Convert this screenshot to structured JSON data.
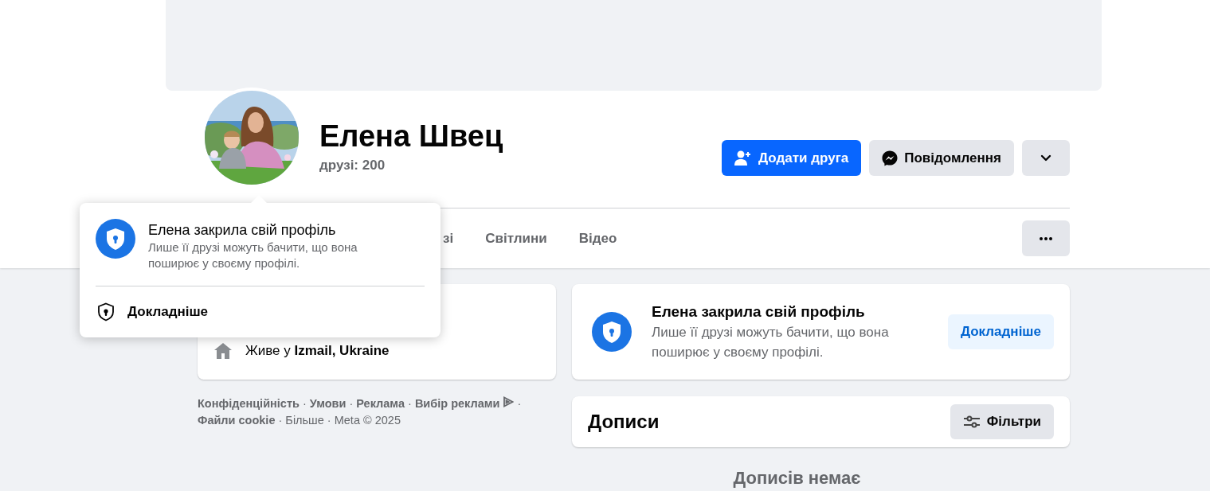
{
  "profile": {
    "name": "Елена Швец",
    "friends": "друзі: 200"
  },
  "actions": [
    {
      "kind": "add_friend",
      "label": "Додати друга"
    },
    {
      "kind": "message",
      "label": "Повідомлення"
    },
    {
      "kind": "dropdown"
    }
  ],
  "tabs": [
    {
      "label": "зі",
      "selected": false
    },
    {
      "label": "Світлини",
      "selected": false
    },
    {
      "label": "Відео",
      "selected": false
    }
  ],
  "popup": {
    "title": "Елена закрила свій профіль",
    "text": "Лише її друзі можуть бачити, що вона поширює у своєму профілі.",
    "link": "Докладніше"
  },
  "intro": {
    "lives_in": "Живе у **Izmail, Ukraine**"
  },
  "footer": {
    "separator": "·",
    "links": [
      {
        "text": "Конфіденційність",
        "bold": true
      },
      {
        "text": "Умови",
        "bold": true
      },
      {
        "text": "Реклама",
        "bold": true
      },
      {
        "text": "Вибір реклами",
        "bold": true,
        "kind": "adchoices"
      },
      {
        "text": "Файли cookie",
        "bold": true
      },
      {
        "text": "Більше",
        "bold": false
      },
      {
        "text": "Meta © 2025",
        "bold": false
      }
    ]
  },
  "locked_card": {
    "title": "Елена закрила свій профіль",
    "text": "Лише її друзі можуть бачити, що вона поширює у своєму профілі.",
    "button": "Докладніше"
  },
  "posts": {
    "title": "Дописи",
    "filter_button": "Фільтри",
    "empty": "Дописів немає"
  }
}
